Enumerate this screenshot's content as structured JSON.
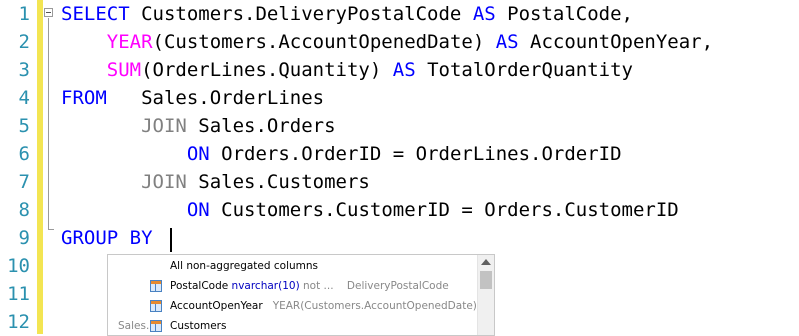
{
  "editor": {
    "line_numbers": [
      "1",
      "2",
      "3",
      "4",
      "5",
      "6",
      "7",
      "8",
      "9",
      "10",
      "11",
      "12"
    ],
    "lines": [
      [
        {
          "t": "SELECT ",
          "c": "kw"
        },
        {
          "t": "Customers.DeliveryPostalCode ",
          "c": ""
        },
        {
          "t": "AS ",
          "c": "kw"
        },
        {
          "t": "PostalCode,",
          "c": ""
        }
      ],
      [
        {
          "t": "    ",
          "c": ""
        },
        {
          "t": "YEAR",
          "c": "fn"
        },
        {
          "t": "(Customers.AccountOpenedDate) ",
          "c": ""
        },
        {
          "t": "AS ",
          "c": "kw"
        },
        {
          "t": "AccountOpenYear,",
          "c": ""
        }
      ],
      [
        {
          "t": "    ",
          "c": ""
        },
        {
          "t": "SUM",
          "c": "fn"
        },
        {
          "t": "(OrderLines.Quantity) ",
          "c": ""
        },
        {
          "t": "AS ",
          "c": "kw"
        },
        {
          "t": "TotalOrderQuantity",
          "c": ""
        }
      ],
      [
        {
          "t": "FROM   ",
          "c": "kw"
        },
        {
          "t": "Sales.OrderLines",
          "c": ""
        }
      ],
      [
        {
          "t": "       ",
          "c": ""
        },
        {
          "t": "JOIN ",
          "c": "gray"
        },
        {
          "t": "Sales.Orders",
          "c": ""
        }
      ],
      [
        {
          "t": "           ",
          "c": ""
        },
        {
          "t": "ON ",
          "c": "kw"
        },
        {
          "t": "Orders.OrderID = OrderLines.OrderID",
          "c": ""
        }
      ],
      [
        {
          "t": "       ",
          "c": ""
        },
        {
          "t": "JOIN ",
          "c": "gray"
        },
        {
          "t": "Sales.Customers",
          "c": ""
        }
      ],
      [
        {
          "t": "           ",
          "c": ""
        },
        {
          "t": "ON ",
          "c": "kw"
        },
        {
          "t": "Customers.CustomerID = Orders.CustomerID",
          "c": ""
        }
      ],
      [
        {
          "t": "GROUP BY ",
          "c": "kw"
        }
      ]
    ]
  },
  "intellisense": {
    "header": "All non-aggregated columns",
    "items": [
      {
        "name": "PostalCode",
        "type": "nvarchar(10)",
        "null": "not ...",
        "desc": "DeliveryPostalCode"
      },
      {
        "name": "AccountOpenYear",
        "type": "",
        "null": "",
        "desc": "YEAR(Customers.AccountOpenedDate)"
      },
      {
        "prefix": "Sales.",
        "name": "Customers",
        "type": "",
        "null": "",
        "desc": ""
      }
    ]
  },
  "colors": {
    "keyword": "#0000ff",
    "function": "#ff00ff",
    "join": "#808080",
    "line_number": "#2b91af",
    "change_bar": "#f3e552"
  }
}
